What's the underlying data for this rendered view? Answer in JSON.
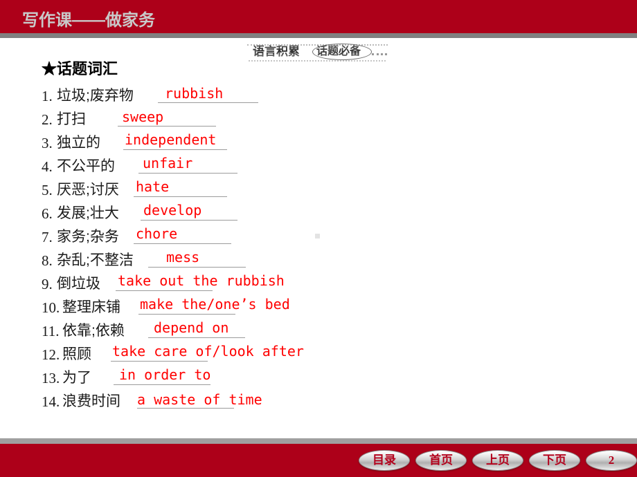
{
  "header": {
    "title": "写作课——做家务",
    "bg_color": "#ad0019",
    "title_color": "#c9c9c9"
  },
  "banner": {
    "label": "语言积累",
    "oval_label": "话题必备"
  },
  "content": {
    "topic_heading": "★话题词汇",
    "answer_color": "#ff0000",
    "items": [
      {
        "num": "1.",
        "cn": "垃圾;废弃物",
        "answer": "rubbish"
      },
      {
        "num": "2.",
        "cn": "打扫",
        "answer": "sweep"
      },
      {
        "num": "3.",
        "cn": "独立的",
        "answer": "independent"
      },
      {
        "num": "4.",
        "cn": "不公平的",
        "answer": "unfair"
      },
      {
        "num": "5.",
        "cn": "厌恶;讨厌",
        "answer": "hate"
      },
      {
        "num": "6.",
        "cn": "发展;壮大",
        "answer": "develop"
      },
      {
        "num": "7.",
        "cn": "家务;杂务",
        "answer": "chore"
      },
      {
        "num": "8.",
        "cn": "杂乱;不整洁",
        "answer": "mess"
      },
      {
        "num": "9.",
        "cn": "倒垃圾",
        "answer": "take out the rubbish"
      },
      {
        "num": "10.",
        "cn": "整理床铺",
        "answer": "make the/one’s bed"
      },
      {
        "num": "11.",
        "cn": "依靠;依赖",
        "answer": "depend on"
      },
      {
        "num": "12.",
        "cn": "照顾",
        "answer": "take care of/look after"
      },
      {
        "num": "13.",
        "cn": "为了",
        "answer": "in order to"
      },
      {
        "num": "14.",
        "cn": "浪费时间",
        "answer": "a waste of time"
      }
    ]
  },
  "footer": {
    "bg_color": "#ad0019",
    "buttons": [
      {
        "label": "目录"
      },
      {
        "label": "首页"
      },
      {
        "label": "上页"
      },
      {
        "label": "下页"
      }
    ],
    "page_number": "2"
  }
}
